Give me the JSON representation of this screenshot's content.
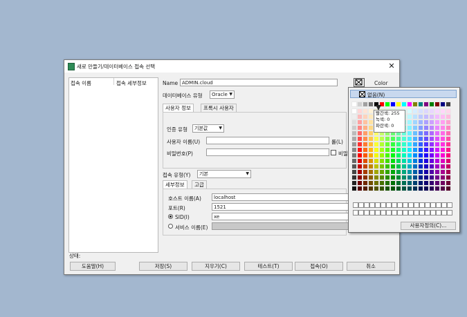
{
  "dialog": {
    "title": "새로 만들기/데이터베이스 접속 선택",
    "close": "✕",
    "list_headers": [
      "접속 이름",
      "접속 세부정보"
    ],
    "status_label": "상태:",
    "name_label": "Name",
    "name_value": "ADMIN.cloud",
    "color_label": "Color",
    "db_type_label": "데이터베이스 유형",
    "db_type_value": "Oracle",
    "tabs": [
      "사용자 정보",
      "프록시 사용자"
    ],
    "auth_type_label": "인증 유형",
    "auth_type_value": "기본값",
    "username_label": "사용자 이름(U)",
    "password_label": "비밀번호(P)",
    "role_label": "롤(L)",
    "save_pw_label": "비밀",
    "conn_type_label": "접속 유형(Y)",
    "conn_type_value": "기본",
    "detail_tabs": [
      "세부정보",
      "고급"
    ],
    "host_label": "호스트 이름(A)",
    "host_value": "localhost",
    "port_label": "포트(R)",
    "port_value": "1521",
    "sid_label": "SID(I)",
    "sid_value": "xe",
    "service_label": "서비스 이름(E)",
    "buttons": {
      "help": "도움말(H)",
      "save": "저장(S)",
      "clear": "지우기(C)",
      "test": "테스트(T)",
      "connect": "접속(O)",
      "cancel": "취소"
    }
  },
  "color_popup": {
    "none_label": "없음(N)",
    "custom_label": "사용자정의(C)...",
    "tooltip": [
      "빨간색: 255",
      "녹색: 0",
      "파란색: 0"
    ],
    "top_row_colors": [
      "#ffffff",
      "#d0d0d0",
      "#a0a0a0",
      "#707070",
      "#000000",
      "#ff0000",
      "#00ff00",
      "#0000ff",
      "#ffff00",
      "#00ffff",
      "#ff00ff",
      "#808000",
      "#008080",
      "#800080",
      "#008000",
      "#800000",
      "#000080",
      "#404040"
    ]
  }
}
